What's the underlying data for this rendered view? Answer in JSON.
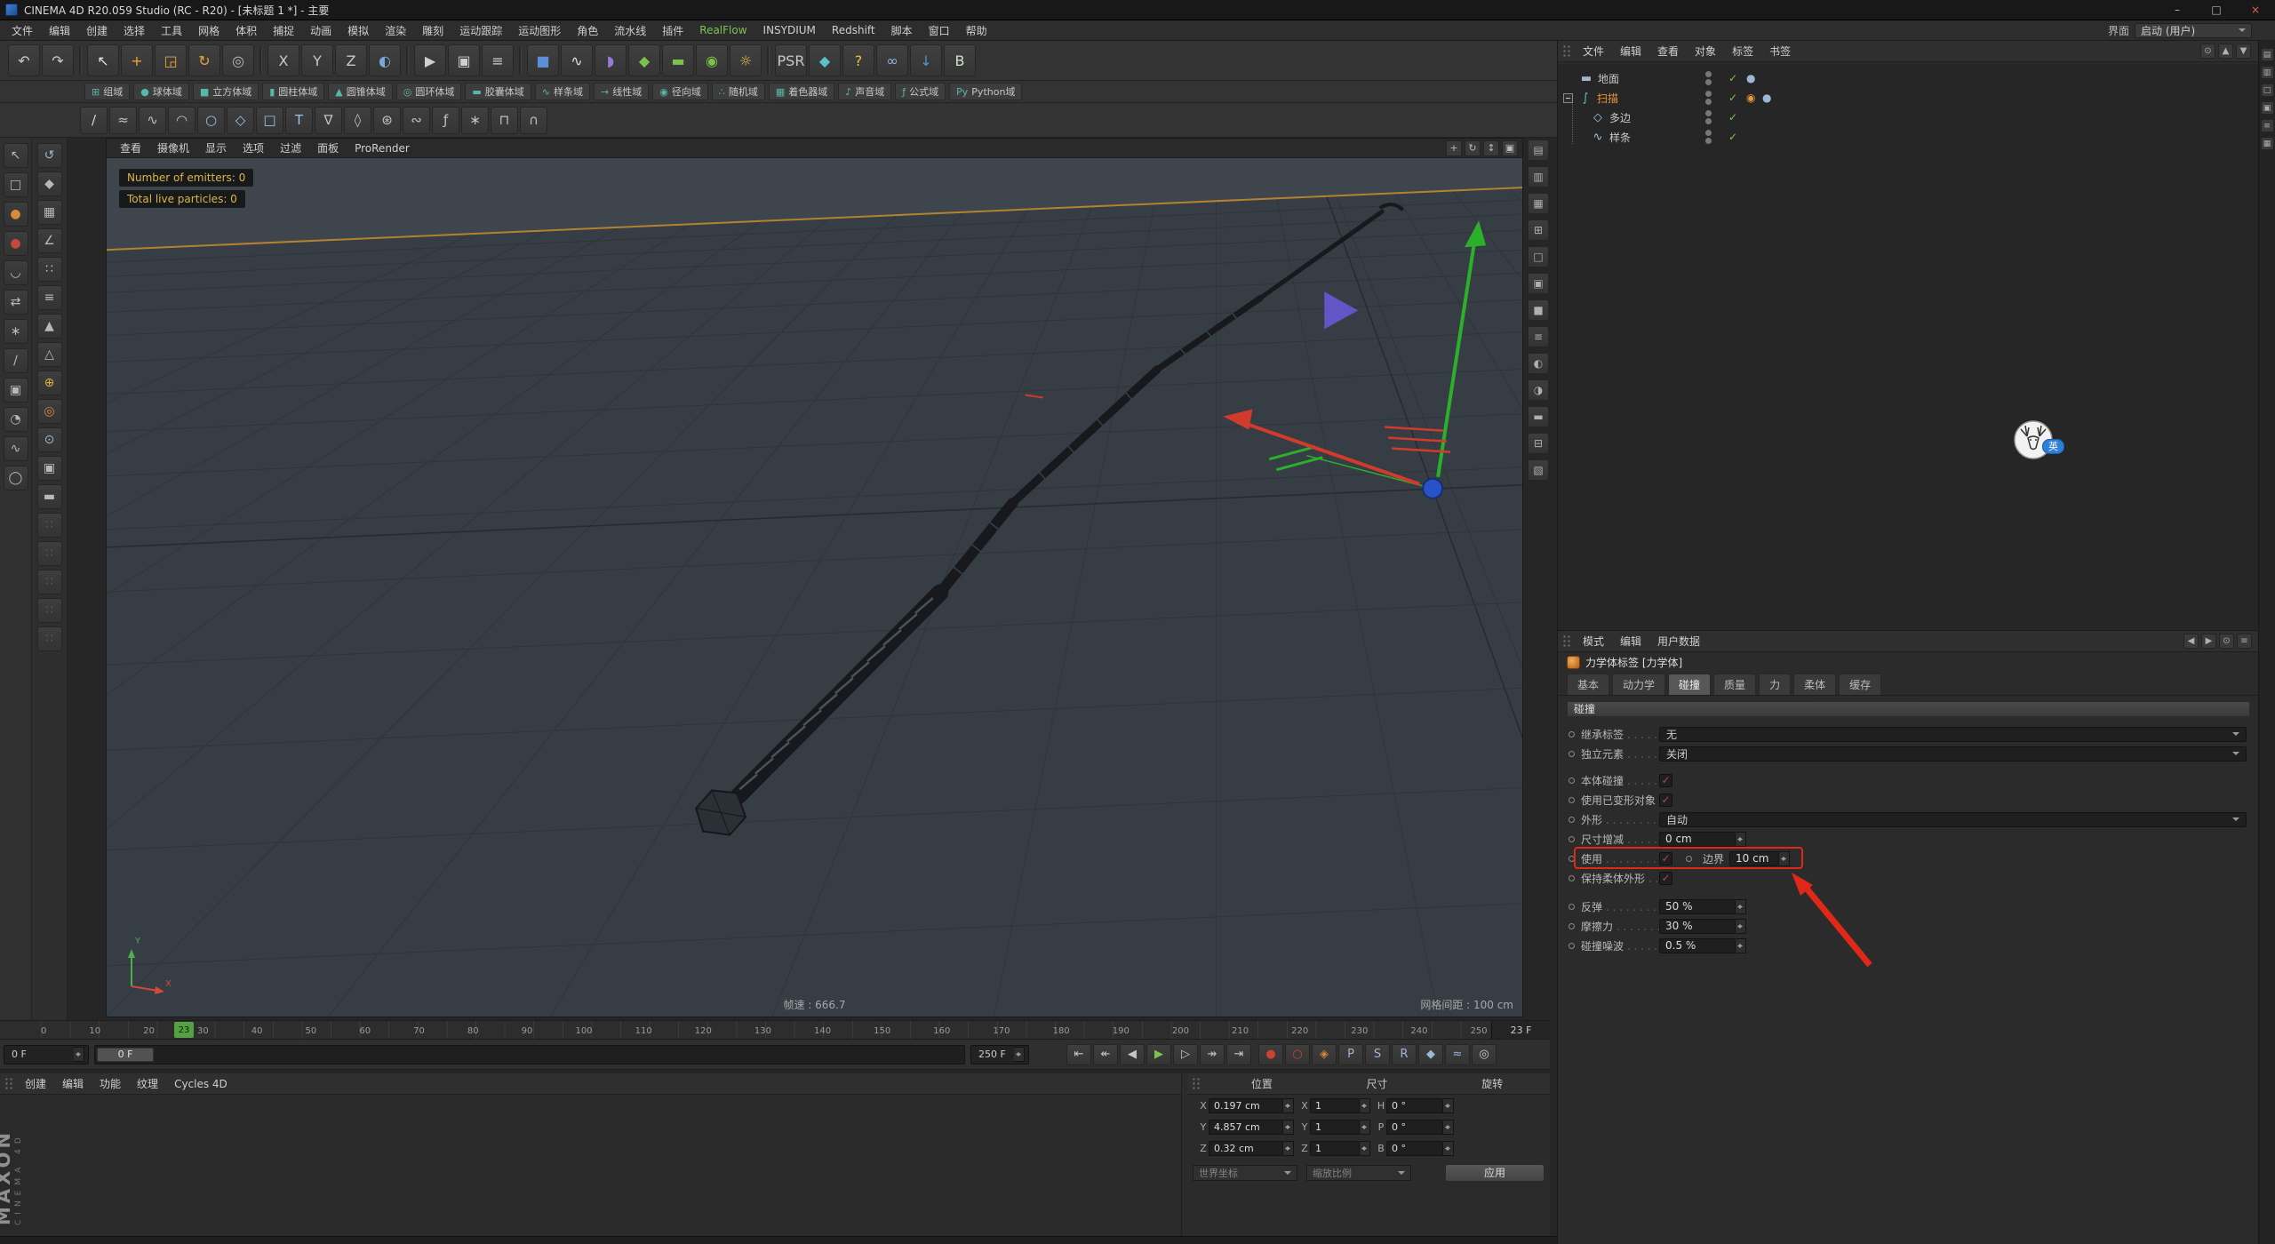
{
  "window": {
    "title": "CINEMA 4D R20.059 Studio (RC - R20) - [未标题 1 *] - 主要",
    "minimize": "–",
    "maximize": "□",
    "close": "×"
  },
  "menu_bar": {
    "items": [
      {
        "label": "文件"
      },
      {
        "label": "编辑"
      },
      {
        "label": "创建"
      },
      {
        "label": "选择"
      },
      {
        "label": "工具"
      },
      {
        "label": "网格"
      },
      {
        "label": "体积"
      },
      {
        "label": "捕捉"
      },
      {
        "label": "动画"
      },
      {
        "label": "模拟"
      },
      {
        "label": "渲染"
      },
      {
        "label": "雕刻"
      },
      {
        "label": "运动跟踪"
      },
      {
        "label": "运动图形"
      },
      {
        "label": "角色"
      },
      {
        "label": "流水线"
      },
      {
        "label": "插件"
      },
      {
        "label": "RealFlow",
        "color": "#7fc24f"
      },
      {
        "label": "INSYDIUM"
      },
      {
        "label": "Redshift"
      },
      {
        "label": "脚本"
      },
      {
        "label": "窗口"
      },
      {
        "label": "帮助"
      }
    ],
    "interface_label": "界面",
    "layout_value": "启动 (用户)"
  },
  "toolbar": {
    "icons": [
      {
        "name": "undo-icon",
        "glyph": "↶"
      },
      {
        "name": "redo-icon",
        "glyph": "↷"
      },
      {
        "sep": true
      },
      {
        "name": "live-selection-icon",
        "glyph": "↖",
        "color": "#e0e0e0"
      },
      {
        "name": "move-tool-icon",
        "glyph": "+",
        "color": "#e8a33d"
      },
      {
        "name": "scale-tool-icon",
        "glyph": "◲",
        "color": "#e8a33d"
      },
      {
        "name": "rotate-tool-icon",
        "glyph": "↻",
        "color": "#e8a33d"
      },
      {
        "name": "last-tool-icon",
        "glyph": "◎",
        "color": "#b8b8b8"
      },
      {
        "sep": true
      },
      {
        "name": "lock-x-axis-icon",
        "glyph": "X"
      },
      {
        "name": "lock-y-axis-icon",
        "glyph": "Y"
      },
      {
        "name": "lock-z-axis-icon",
        "glyph": "Z"
      },
      {
        "name": "coordinate-system-icon",
        "glyph": "◐",
        "color": "#7aa7d6"
      },
      {
        "sep": true
      },
      {
        "name": "render-view-icon",
        "glyph": "▶",
        "color": "#cfcfcf"
      },
      {
        "name": "render-picture-viewer-icon",
        "glyph": "▣",
        "color": "#cfcfcf"
      },
      {
        "name": "render-settings-icon",
        "glyph": "≡",
        "color": "#cfcfcf"
      },
      {
        "sep": true
      },
      {
        "name": "primitive-cube-icon",
        "glyph": "■",
        "color": "#5b8fd6"
      },
      {
        "name": "spline-pen-icon",
        "glyph": "∿",
        "color": "#e0e0e0"
      },
      {
        "name": "deformer-icon",
        "glyph": "◗",
        "color": "#9a7ad6"
      },
      {
        "name": "subdivision-surface-icon",
        "glyph": "◆",
        "color": "#7dc14d"
      },
      {
        "name": "floor-icon",
        "glyph": "▬",
        "color": "#7dc14d"
      },
      {
        "name": "camera-icon",
        "glyph": "◉",
        "color": "#7dc14d"
      },
      {
        "name": "light-icon",
        "glyph": "☼",
        "color": "#e8c33d"
      },
      {
        "sep": true
      },
      {
        "name": "psr-reset-icon",
        "glyph": "PSR",
        "color": "#c8c8c8"
      },
      {
        "name": "axis-center-icon",
        "glyph": "◆",
        "color": "#59c2c6"
      },
      {
        "name": "help-icon",
        "glyph": "?",
        "color": "#e8c33d"
      },
      {
        "name": "rings-icon",
        "glyph": "∞",
        "color": "#8fb8e0"
      },
      {
        "name": "bridge-download-icon",
        "glyph": "↓",
        "color": "#5b8fd6"
      },
      {
        "name": "plugin-b-icon",
        "glyph": "B",
        "color": "#cfe0d0"
      }
    ]
  },
  "fields": {
    "items": [
      {
        "name": "group-field-button",
        "glyph": "⊞",
        "label": "组域"
      },
      {
        "name": "sphere-field-button",
        "glyph": "●",
        "label": "球体域"
      },
      {
        "name": "cube-field-button",
        "glyph": "■",
        "label": "立方体域"
      },
      {
        "name": "cylinder-field-button",
        "glyph": "▮",
        "label": "圆柱体域"
      },
      {
        "name": "cone-field-button",
        "glyph": "▲",
        "label": "圆锥体域"
      },
      {
        "name": "torus-field-button",
        "glyph": "◎",
        "label": "圆环体域"
      },
      {
        "name": "capsule-field-button",
        "glyph": "▬",
        "label": "胶囊体域"
      },
      {
        "name": "spline-field-button",
        "glyph": "∿",
        "label": "样条域"
      },
      {
        "name": "linear-field-button",
        "glyph": "→",
        "label": "线性域"
      },
      {
        "name": "radial-field-button",
        "glyph": "◉",
        "label": "径向域"
      },
      {
        "name": "random-field-button",
        "glyph": "∴",
        "label": "随机域"
      },
      {
        "name": "shader-field-button",
        "glyph": "▦",
        "label": "着色器域"
      },
      {
        "name": "sound-field-button",
        "glyph": "♪",
        "label": "声音域"
      },
      {
        "name": "formula-field-button",
        "glyph": "ƒ",
        "label": "公式域"
      },
      {
        "name": "python-field-button",
        "glyph": "Py",
        "label": "Python域"
      }
    ]
  },
  "spline_tools": {
    "icons": [
      {
        "name": "pen-tool-icon",
        "glyph": "∕",
        "color": "#d8d8d8"
      },
      {
        "name": "sketch-tool-icon",
        "glyph": "≈"
      },
      {
        "name": "spline-smooth-icon",
        "glyph": "∿"
      },
      {
        "name": "spline-arc-icon",
        "glyph": "◠"
      },
      {
        "name": "circle-spline-icon",
        "glyph": "○",
        "color": "#9fc1e0"
      },
      {
        "name": "polygon-spline-icon",
        "glyph": "◇",
        "color": "#9fc1e0"
      },
      {
        "name": "rectangle-spline-icon",
        "glyph": "□",
        "color": "#9fc1e0"
      },
      {
        "name": "text-spline-icon",
        "glyph": "T",
        "color": "#9fc1e0"
      },
      {
        "name": "vectorizer-icon",
        "glyph": "∇"
      },
      {
        "name": "quad-spline-icon",
        "glyph": "◊"
      },
      {
        "name": "cogwheel-spline-icon",
        "glyph": "⊛"
      },
      {
        "name": "cycloid-spline-icon",
        "glyph": "∾"
      },
      {
        "name": "formula-spline-icon",
        "glyph": "ƒ"
      },
      {
        "name": "flower-spline-icon",
        "glyph": "∗"
      },
      {
        "name": "profile-spline-icon",
        "glyph": "⊓"
      },
      {
        "name": "contour-spline-icon",
        "glyph": "∩"
      }
    ]
  },
  "left_palette": {
    "col1": [
      {
        "name": "selection-filter-icon",
        "glyph": "↖"
      },
      {
        "name": "rect-select-icon",
        "glyph": "□"
      },
      {
        "name": "sculpt-pull-icon",
        "glyph": "●",
        "color": "#d98a3d"
      },
      {
        "name": "sculpt-wax-icon",
        "glyph": "●",
        "color": "#c44a3d"
      },
      {
        "name": "magnet-tool-icon",
        "glyph": "◡"
      },
      {
        "name": "mirror-tool-icon",
        "glyph": "⇄"
      },
      {
        "name": "brush-tool-icon",
        "glyph": "∗"
      },
      {
        "name": "knife-tool-icon",
        "glyph": "∕"
      },
      {
        "name": "stamp-tool-icon",
        "glyph": "▣"
      },
      {
        "name": "mask-tool-icon",
        "glyph": "◔"
      },
      {
        "name": "smooth-tool-icon",
        "glyph": "∿"
      },
      {
        "name": "inflate-tool-icon",
        "glyph": "◯"
      }
    ],
    "col2": [
      {
        "name": "make-editable-icon",
        "glyph": "↺",
        "color": "#9fb6cc"
      },
      {
        "name": "model-mode-icon",
        "glyph": "◆"
      },
      {
        "name": "texture-mode-icon",
        "glyph": "▦"
      },
      {
        "name": "workplane-mode-icon",
        "glyph": "∠"
      },
      {
        "name": "points-mode-icon",
        "glyph": "∷"
      },
      {
        "name": "edges-mode-icon",
        "glyph": "≡"
      },
      {
        "name": "polygons-mode-icon",
        "glyph": "▲"
      },
      {
        "name": "tweak-mode-icon",
        "glyph": "△"
      },
      {
        "name": "enable-axis-icon",
        "glyph": "⊕",
        "color": "#d9b23d"
      },
      {
        "name": "viewport-solo-icon",
        "glyph": "◎",
        "color": "#d98a3d"
      },
      {
        "name": "snap-toggle-icon",
        "glyph": "⊙",
        "color": "#9fb6cc"
      },
      {
        "name": "quantize-icon",
        "glyph": "▣"
      },
      {
        "name": "workplane-lock-icon",
        "glyph": "▬"
      },
      {
        "name": "grip-icon",
        "glyph": "∷",
        "color": "#5a5a5a"
      },
      {
        "name": "grip-icon",
        "glyph": "∷",
        "color": "#5a5a5a"
      },
      {
        "name": "grip-icon",
        "glyph": "∷",
        "color": "#5a5a5a"
      },
      {
        "name": "grip-icon",
        "glyph": "∷",
        "color": "#5a5a5a"
      },
      {
        "name": "grip-icon",
        "glyph": "∷",
        "color": "#5a5a5a"
      }
    ]
  },
  "viewport": {
    "menu": [
      {
        "label": "查看"
      },
      {
        "label": "摄像机"
      },
      {
        "label": "显示"
      },
      {
        "label": "选项"
      },
      {
        "label": "过滤"
      },
      {
        "label": "面板"
      },
      {
        "label": "ProRender"
      }
    ],
    "nav_icons": [
      {
        "name": "view-pan-icon",
        "glyph": "+"
      },
      {
        "name": "view-orbit-icon",
        "glyph": "↻"
      },
      {
        "name": "view-zoom-icon",
        "glyph": "↕"
      },
      {
        "name": "view-switch-icon",
        "glyph": "▣"
      }
    ],
    "hud": {
      "emitters": "Number of emitters: 0",
      "particles": "Total live particles: 0"
    },
    "fps": "帧速 : 666.7",
    "grid": "网格间距 : 100 cm",
    "axis_x": "X",
    "axis_y": "Y"
  },
  "right_dock": {
    "icons": [
      {
        "name": "dock-icon",
        "glyph": "▤"
      },
      {
        "name": "dock-icon",
        "glyph": "▥"
      },
      {
        "name": "dock-icon",
        "glyph": "▦"
      },
      {
        "name": "dock-icon",
        "glyph": "⊞"
      },
      {
        "name": "dock-icon",
        "glyph": "□"
      },
      {
        "name": "dock-icon",
        "glyph": "▣"
      },
      {
        "name": "dock-icon",
        "glyph": "■"
      },
      {
        "name": "dock-icon",
        "glyph": "≡"
      },
      {
        "name": "dock-icon",
        "glyph": "◐"
      },
      {
        "name": "dock-icon",
        "glyph": "◑"
      },
      {
        "name": "dock-icon",
        "glyph": "▬"
      },
      {
        "name": "dock-icon",
        "glyph": "⊟"
      },
      {
        "name": "dock-icon",
        "glyph": "▧"
      }
    ]
  },
  "timeline": {
    "ticks": [
      "0",
      "10",
      "20",
      "30",
      "40",
      "50",
      "60",
      "70",
      "80",
      "90",
      "100",
      "110",
      "120",
      "130",
      "140",
      "150",
      "160",
      "170",
      "180",
      "190",
      "200",
      "210",
      "220",
      "230",
      "240",
      "250"
    ],
    "playhead": "23",
    "frame_label": "23 F",
    "start_value": "0 F",
    "end_value": "250 F",
    "handle": "0 F",
    "transport": [
      {
        "name": "goto-start-button",
        "glyph": "⇤"
      },
      {
        "name": "goto-prev-key-button",
        "glyph": "↞"
      },
      {
        "name": "prev-frame-button",
        "glyph": "◀"
      },
      {
        "name": "play-button",
        "glyph": "▶",
        "color": "#7ec14d"
      },
      {
        "name": "next-frame-button",
        "glyph": "▷"
      },
      {
        "name": "goto-next-key-button",
        "glyph": "↠"
      },
      {
        "name": "goto-end-button",
        "glyph": "⇥"
      }
    ],
    "keys": [
      {
        "name": "record-button",
        "glyph": "●",
        "color": "#cc4233"
      },
      {
        "name": "autokey-button",
        "glyph": "○",
        "color": "#cc4233"
      },
      {
        "name": "keyframe-selection-button",
        "glyph": "◈",
        "color": "#cc8833"
      },
      {
        "name": "position-key-toggle",
        "glyph": "P",
        "color": "#9db6d6"
      },
      {
        "name": "scale-key-toggle",
        "glyph": "S",
        "color": "#9db6d6"
      },
      {
        "name": "rotation-key-toggle",
        "glyph": "R",
        "color": "#9db6d6"
      },
      {
        "name": "parameter-key-toggle",
        "glyph": "◆",
        "color": "#9db6d6"
      },
      {
        "name": "pla-key-toggle",
        "glyph": "≈",
        "color": "#9db6d6"
      },
      {
        "name": "solo-button",
        "glyph": "◎",
        "color": "#cccccc"
      }
    ]
  },
  "materials": {
    "menu": [
      {
        "label": "创建"
      },
      {
        "label": "编辑"
      },
      {
        "label": "功能"
      },
      {
        "label": "纹理"
      },
      {
        "label": "Cycles 4D"
      }
    ]
  },
  "brand": {
    "maxon": "MAXON",
    "cinema": "CINEMA 4D"
  },
  "coords": {
    "headers": [
      "位置",
      "尺寸",
      "旋转"
    ],
    "rows": [
      {
        "p_label": "X",
        "p": "0.197 cm",
        "s_label": "X",
        "s": "1",
        "r_label": "H",
        "r": "0 °"
      },
      {
        "p_label": "Y",
        "p": "4.857 cm",
        "s_label": "Y",
        "s": "1",
        "r_label": "P",
        "r": "0 °"
      },
      {
        "p_label": "Z",
        "p": "0.32 cm",
        "s_label": "Z",
        "s": "1",
        "r_label": "B",
        "r": "0 °"
      }
    ],
    "mode1": "世界坐标",
    "mode2": "缩放比例",
    "apply": "应用"
  },
  "object_manager": {
    "menu": [
      {
        "label": "文件"
      },
      {
        "label": "编辑"
      },
      {
        "label": "查看"
      },
      {
        "label": "对象"
      },
      {
        "label": "标签"
      },
      {
        "label": "书签"
      }
    ],
    "icons": [
      {
        "name": "om-search-icon",
        "glyph": "⊙"
      },
      {
        "name": "om-prev-icon",
        "glyph": "▲"
      },
      {
        "name": "om-next-icon",
        "glyph": "▼"
      }
    ],
    "objects": {
      "floor": {
        "name": "地面",
        "icon": "▬"
      },
      "sweep": {
        "name": "扫描",
        "icon": "∫"
      },
      "nside": {
        "name": "多边",
        "icon": "◇"
      },
      "spline": {
        "name": "样条",
        "icon": "∿"
      }
    },
    "glyphs": {
      "check": "✓",
      "phong": "●",
      "dynamics": "◉"
    }
  },
  "attribute_manager": {
    "menu": [
      {
        "label": "模式"
      },
      {
        "label": "编辑"
      },
      {
        "label": "用户数据"
      }
    ],
    "icons": [
      {
        "name": "am-back-icon",
        "glyph": "◀"
      },
      {
        "name": "am-forward-icon",
        "glyph": "▶"
      },
      {
        "name": "am-lock-icon",
        "glyph": "⊙"
      },
      {
        "name": "am-menu-icon",
        "glyph": "≡"
      }
    ],
    "title": "力学体标签 [力学体]",
    "tabs": [
      {
        "label": "基本"
      },
      {
        "label": "动力学"
      },
      {
        "label": "碰撞",
        "active": true
      },
      {
        "label": "质量"
      },
      {
        "label": "力"
      },
      {
        "label": "柔体"
      },
      {
        "label": "缓存"
      }
    ],
    "section": "碰撞",
    "check": "✓",
    "rows": {
      "inherit": {
        "label": "继承标签",
        "value": "无"
      },
      "individual": {
        "label": "独立元素",
        "value": "关闭"
      },
      "self_collision": {
        "label": "本体碰撞"
      },
      "use_deformed": {
        "label": "使用已变形对象"
      },
      "shape": {
        "label": "外形",
        "value": "自动"
      },
      "size_inc": {
        "label": "尺寸增减",
        "value": "0 cm"
      },
      "use": {
        "label": "使用",
        "bound_label": "边界",
        "bound_value": "10 cm"
      },
      "keep_shape": {
        "label": "保持柔体外形"
      },
      "bounce": {
        "label": "反弹",
        "value": "50 %"
      },
      "friction": {
        "label": "摩擦力",
        "value": "30 %"
      },
      "noise": {
        "label": "碰撞噪波",
        "value": "0.5 %"
      }
    }
  },
  "right_strip": {
    "icons": [
      {
        "name": "layout-tab-icon",
        "glyph": "▤"
      },
      {
        "name": "layout-tab-icon",
        "glyph": "▥"
      },
      {
        "name": "layout-tab-icon",
        "glyph": "□"
      },
      {
        "name": "layout-tab-icon",
        "glyph": "▣"
      },
      {
        "name": "layout-tab-icon",
        "glyph": "≡"
      },
      {
        "name": "layout-tab-icon",
        "glyph": "▦"
      }
    ]
  },
  "badge": {
    "label": "英"
  },
  "colors": {
    "accent_orange": "#e8963c",
    "annotation_red": "#e02818",
    "play_green": "#7ec14d"
  }
}
